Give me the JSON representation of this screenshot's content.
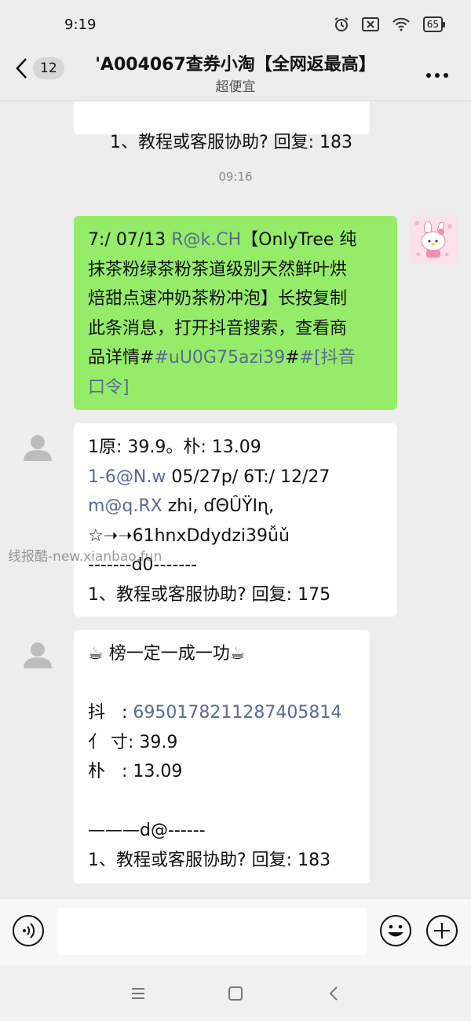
{
  "status_bar": {
    "time": "9:19",
    "battery": "65"
  },
  "header": {
    "back_badge": "12",
    "title": "'A004067查券小淘【全网返最高】",
    "subtitle": "超便宜"
  },
  "messages": {
    "top_partial": {
      "text": "1、教程或客服协助? 回复: 183"
    },
    "timestamp": "09:16",
    "sent": {
      "p1": "7:/ 07/13 ",
      "l1": "R@k.CH",
      "p2": "【OnlyTree 纯\n抹茶粉绿茶粉茶道级别天然鲜叶烘\n焙甜点速冲奶茶粉冲泡】长按复制\n此条消息，打开抖音搜索，查看商\n品详情#",
      "l2": "#uU0G75azi39",
      "p3": "#",
      "l3": "#[抖音\n口令]"
    },
    "recv1": {
      "p1": "1原: 39.9。朴: 13.09\n",
      "l1": "1-6@N.w",
      "p2": " 05/27p/ 6T:/ 12/27\n",
      "l2": "m@q.RX",
      "p3": " zhi, ɗΘÛŸIɳ,\n☆➝➝61hnxDdydzi39ǚǔ\n-------d0-------\n1、教程或客服协助? 回复: 175"
    },
    "recv2": {
      "p1": "☕ 榜一定一成一功☕\n\n抖   : ",
      "l1": "6950178211287405814",
      "p2": "\n亻 寸: 39.9\n朴   : 13.09\n\n———d@------\n1、教程或客服协助? 回复: 183"
    }
  },
  "watermark": "线报酷-new.xianbao.fun",
  "input_bar": {
    "value": ""
  },
  "colors": {
    "sent_bubble": "#95ec69",
    "link": "#576b95",
    "background": "#ededed"
  }
}
